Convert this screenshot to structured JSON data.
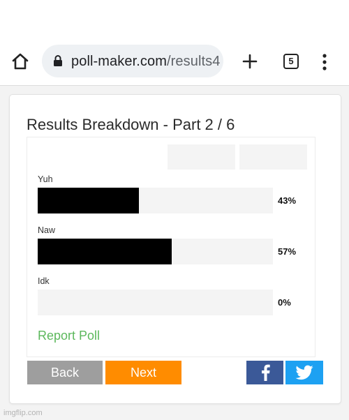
{
  "browser": {
    "url_domain": "poll-maker.com",
    "url_path": "/results4",
    "tab_count": "5"
  },
  "poll": {
    "title": "Results Breakdown - Part 2 / 6",
    "options": [
      {
        "label": "Yuh",
        "percent_text": "43%",
        "percent": 43
      },
      {
        "label": "Naw",
        "percent_text": "57%",
        "percent": 57
      },
      {
        "label": "Idk",
        "percent_text": "0%",
        "percent": 0
      }
    ],
    "report_label": "Report Poll",
    "bar_color": "#000000",
    "link_color": "#5cb85c"
  },
  "actions": {
    "back_label": "Back",
    "next_label": "Next",
    "facebook_icon": "facebook-icon",
    "twitter_icon": "twitter-icon",
    "back_color": "#9e9e9e",
    "next_color": "#ff8c00"
  },
  "watermark": "imgflip.com"
}
